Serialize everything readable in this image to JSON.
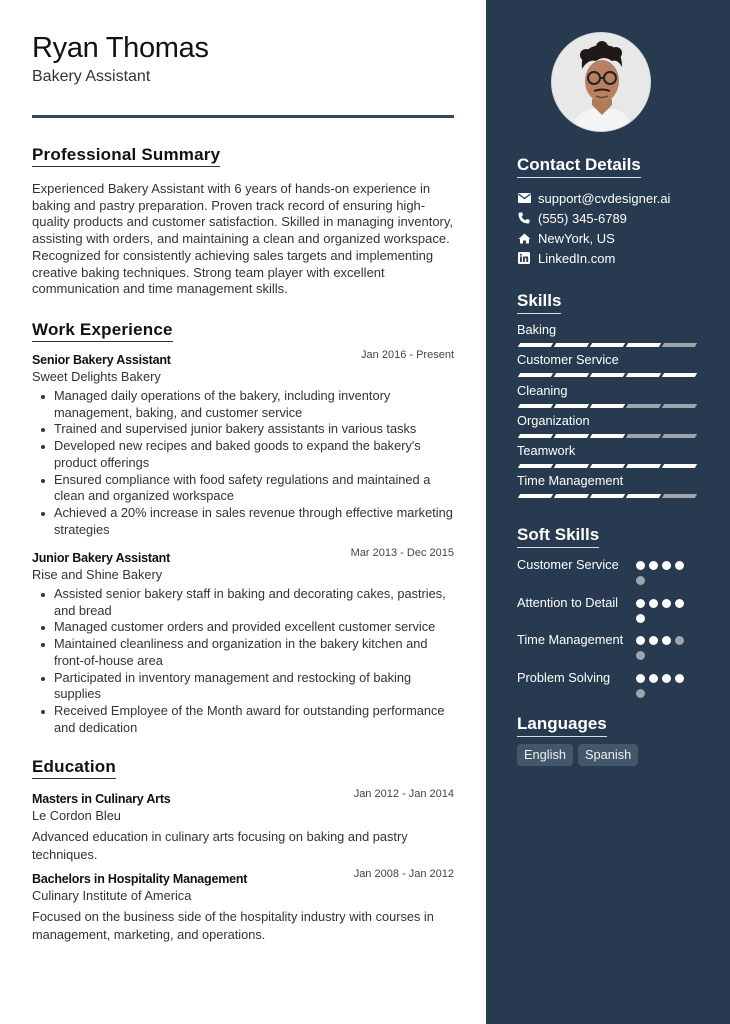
{
  "header": {
    "name": "Ryan Thomas",
    "title": "Bakery Assistant"
  },
  "sections": {
    "summary_title": "Professional Summary",
    "experience_title": "Work Experience",
    "education_title": "Education"
  },
  "summary": "Experienced Bakery Assistant with 6 years of hands-on experience in baking and pastry preparation. Proven track record of ensuring high-quality products and customer satisfaction. Skilled in managing inventory, assisting with orders, and maintaining a clean and organized workspace. Recognized for consistently achieving sales targets and implementing creative baking techniques. Strong team player with excellent communication and time management skills.",
  "experience": [
    {
      "role": "Senior Bakery Assistant",
      "company": "Sweet Delights Bakery",
      "dates": "Jan 2016 - Present",
      "bullets": [
        "Managed daily operations of the bakery, including inventory management, baking, and customer service",
        "Trained and supervised junior bakery assistants in various tasks",
        "Developed new recipes and baked goods to expand the bakery's product offerings",
        "Ensured compliance with food safety regulations and maintained a clean and organized workspace",
        "Achieved a 20% increase in sales revenue through effective marketing strategies"
      ]
    },
    {
      "role": "Junior Bakery Assistant",
      "company": "Rise and Shine Bakery",
      "dates": "Mar 2013 - Dec 2015",
      "bullets": [
        "Assisted senior bakery staff in baking and decorating cakes, pastries, and bread",
        "Managed customer orders and provided excellent customer service",
        "Maintained cleanliness and organization in the bakery kitchen and front-of-house area",
        "Participated in inventory management and restocking of baking supplies",
        "Received Employee of the Month award for outstanding performance and dedication"
      ]
    }
  ],
  "education": [
    {
      "degree": "Masters in Culinary Arts",
      "school": "Le Cordon Bleu",
      "dates": "Jan 2012 - Jan 2014",
      "description": "Advanced education in culinary arts focusing on baking and pastry techniques."
    },
    {
      "degree": "Bachelors in Hospitality Management",
      "school": "Culinary Institute of America",
      "dates": "Jan 2008 - Jan 2012",
      "description": "Focused on the business side of the hospitality industry with courses in management, marketing, and operations."
    }
  ],
  "sidebar": {
    "photo_alt": "profile-photo",
    "contact_title": "Contact Details",
    "contact": [
      {
        "icon": "envelope-icon",
        "text": "support@cvdesigner.ai"
      },
      {
        "icon": "phone-icon",
        "text": "(555) 345-6789"
      },
      {
        "icon": "home-icon",
        "text": "NewYork, US"
      },
      {
        "icon": "linkedin-icon",
        "text": "LinkedIn.com"
      }
    ],
    "skills_title": "Skills",
    "skills": [
      {
        "label": "Baking",
        "level": 4,
        "max": 5
      },
      {
        "label": "Customer Service",
        "level": 5,
        "max": 5
      },
      {
        "label": "Cleaning",
        "level": 3,
        "max": 5
      },
      {
        "label": "Organization",
        "level": 3,
        "max": 5
      },
      {
        "label": "Teamwork",
        "level": 5,
        "max": 5
      },
      {
        "label": "Time Management",
        "level": 4,
        "max": 5
      }
    ],
    "soft_skills_title": "Soft Skills",
    "soft_skills": [
      {
        "label": "Customer Service",
        "level": 4,
        "max": 5
      },
      {
        "label": "Attention to Detail",
        "level": 5,
        "max": 5
      },
      {
        "label": "Time Management",
        "level": 3,
        "max": 5
      },
      {
        "label": "Problem Solving",
        "level": 4,
        "max": 5
      }
    ],
    "languages_title": "Languages",
    "languages": [
      "English",
      "Spanish"
    ]
  },
  "colors": {
    "sidebar_bg": "#273a50",
    "accent_rule": "#33485f",
    "skill_on": "#ffffff",
    "skill_off": "#9ea5ad",
    "chip_bg": "#44566a"
  }
}
